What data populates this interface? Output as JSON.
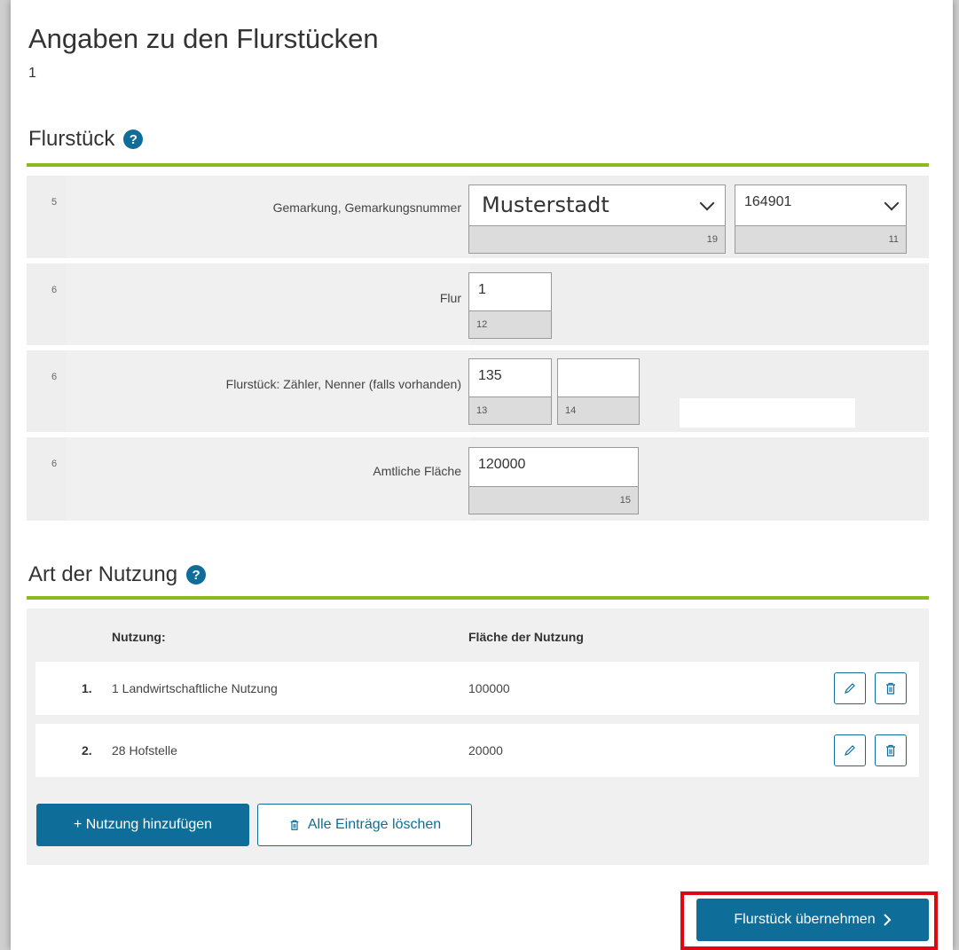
{
  "page": {
    "title": "Angaben zu den Flurstücken",
    "subtitle": "1"
  },
  "flurstueck_section": {
    "heading": "Flurstück",
    "help_icon": "question-circle-icon",
    "rows": [
      {
        "num": "5",
        "label": "Gemarkung,  Gemarkungsnummer",
        "fields": [
          {
            "value": "Musterstadt",
            "foot": "19",
            "type": "select"
          },
          {
            "value": "164901",
            "foot": "11",
            "type": "select"
          }
        ]
      },
      {
        "num": "6",
        "label": "Flur",
        "fields": [
          {
            "value": "1",
            "foot": "12",
            "type": "input"
          }
        ]
      },
      {
        "num": "6",
        "label": "Flurstück: Zähler,  Nenner (falls vorhanden)",
        "fields": [
          {
            "value": "135",
            "foot": "13",
            "type": "input"
          },
          {
            "value": "",
            "foot": "14",
            "type": "input"
          }
        ]
      },
      {
        "num": "6",
        "label": "Amtliche Fläche",
        "fields": [
          {
            "value": "120000",
            "foot": "15",
            "type": "input"
          }
        ]
      }
    ]
  },
  "nutzung_section": {
    "heading": "Art der Nutzung",
    "help_icon": "question-circle-icon",
    "col_nutzung": "Nutzung:",
    "col_flaeche": "Fläche der Nutzung",
    "items": [
      {
        "index": "1.",
        "name": "1 Landwirtschaftliche Nutzung",
        "area": "100000"
      },
      {
        "index": "2.",
        "name": "28 Hofstelle",
        "area": "20000"
      }
    ],
    "add_button": "+ Nutzung hinzufügen",
    "clear_button": "Alle Einträge löschen"
  },
  "footer": {
    "submit_button": "Flurstück übernehmen"
  },
  "colors": {
    "accent_blue": "#0e6e99",
    "rule_green": "#8dbb1f",
    "highlight_red": "#e0070f"
  }
}
